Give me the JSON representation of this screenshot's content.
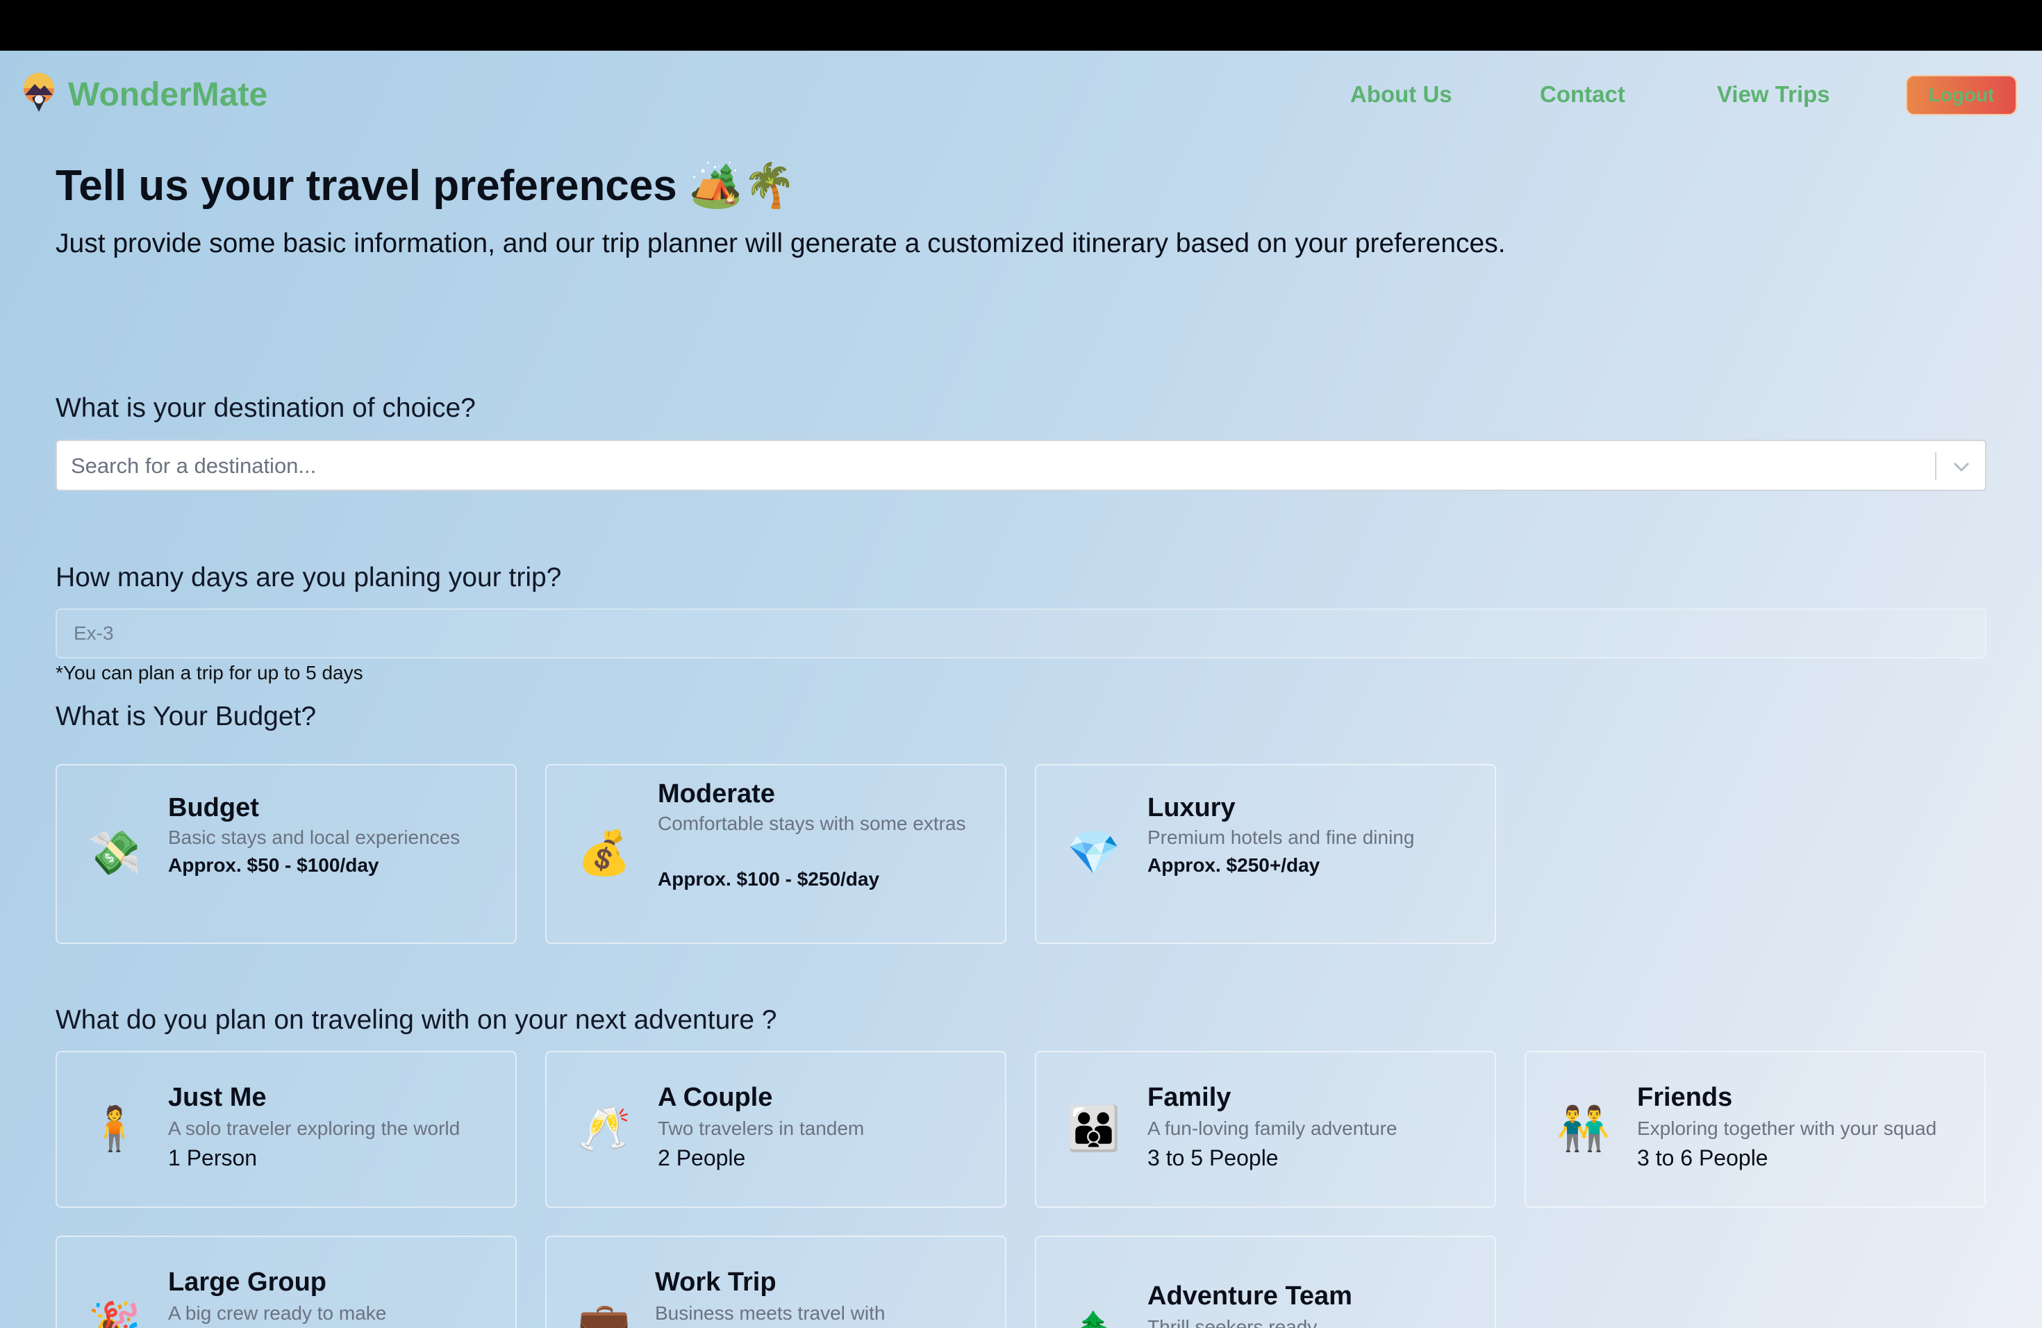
{
  "header": {
    "brand": "WonderMate",
    "nav": [
      "About Us",
      "Contact",
      "View Trips"
    ],
    "logout_label": "Logout"
  },
  "hero": {
    "title": "Tell us your travel preferences 🏕️🌴",
    "subtitle": "Just provide some basic information, and our trip planner will generate a customized itinerary based on your preferences."
  },
  "destination": {
    "question": "What is your destination of choice?",
    "placeholder": "Search for a destination..."
  },
  "days": {
    "question": "How many days are you planing your trip?",
    "placeholder": "Ex-3",
    "hint": "*You can plan a trip for up to 5 days"
  },
  "budget": {
    "question": "What is Your Budget?",
    "options": [
      {
        "icon": "💸",
        "title": "Budget",
        "desc": "Basic stays and local experiences",
        "price": "Approx. $50 - $100/day"
      },
      {
        "icon": "💰",
        "title": "Moderate",
        "desc": "Comfortable stays with some extras",
        "price": "Approx. $100 - $250/day"
      },
      {
        "icon": "💎",
        "title": "Luxury",
        "desc": "Premium hotels and fine dining",
        "price": "Approx. $250+/day"
      }
    ]
  },
  "travelers": {
    "question": "What do you plan on traveling with on your next adventure ?",
    "options": [
      {
        "icon": "🧍",
        "title": "Just Me",
        "desc": "A solo traveler exploring the world",
        "people": "1 Person"
      },
      {
        "icon": "🥂",
        "title": "A Couple",
        "desc": "Two travelers in tandem",
        "people": "2 People"
      },
      {
        "icon": "👪",
        "title": "Family",
        "desc": "A fun-loving family adventure",
        "people": "3 to 5 People"
      },
      {
        "icon": "👬",
        "title": "Friends",
        "desc": "Exploring together with your squad",
        "people": "3 to 6 People"
      },
      {
        "icon": "🎉",
        "title": "Large Group",
        "desc": "A big crew ready to make"
      },
      {
        "icon": "💼",
        "title": "Work Trip",
        "desc": "Business meets travel with"
      },
      {
        "icon": "🌲",
        "title": "Adventure Team",
        "desc": "Thrill seekers ready"
      }
    ]
  },
  "colors": {
    "brand_green": "#5cb270",
    "logout_gradient_start": "#e8874a",
    "logout_gradient_end": "#e2504a"
  },
  "icons": {
    "logo": "mountain-sunset-pin-icon",
    "select_arrow": "chevron-down-icon"
  }
}
